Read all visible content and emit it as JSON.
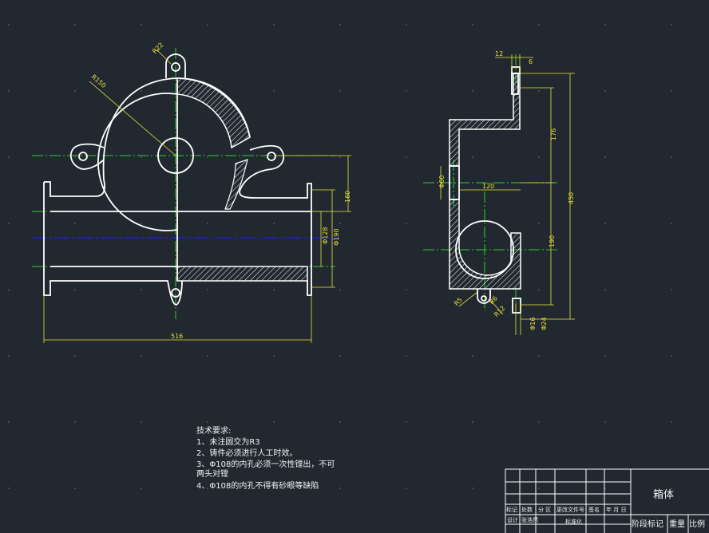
{
  "front_view": {
    "dimensions": {
      "r22": "R22",
      "r150": "R150",
      "h160": "160",
      "d128": "Φ128",
      "d190": "Φ190",
      "w516": "516"
    }
  },
  "side_view": {
    "dimensions": {
      "w12": "12",
      "w6": "6",
      "h176": "176",
      "h450": "450",
      "h190": "190",
      "d60": "Φ60",
      "w120": "120",
      "d16": "Φ16",
      "d24": "Φ24",
      "r5": "R5",
      "r12": "R12",
      "r6": "R6"
    }
  },
  "technical_requirements": {
    "title": "技术要求:",
    "lines": [
      "1、未注圆交为R3",
      "2、铸件必须进行人工时效。",
      "3、Φ108的内孔必须一次性镗出，不可",
      "两头对镗",
      "4、Φ108的内孔不得有砂眼等缺陷"
    ]
  },
  "title_block": {
    "part_name": "箱体",
    "headers": [
      "标记",
      "处数",
      "分 区",
      "更改文件号",
      "签名",
      "年 月 日"
    ],
    "row2": [
      "设计",
      "张浩然",
      "标准化"
    ],
    "right_labels": [
      "阶段标记",
      "重量",
      "比例"
    ]
  },
  "colors": {
    "background": "#212830",
    "outline": "#ffffff",
    "dimension": "#e8e23c",
    "centerline": "#2fd02f",
    "axis": "#2020d0",
    "grid_dot": "#6a7480"
  }
}
